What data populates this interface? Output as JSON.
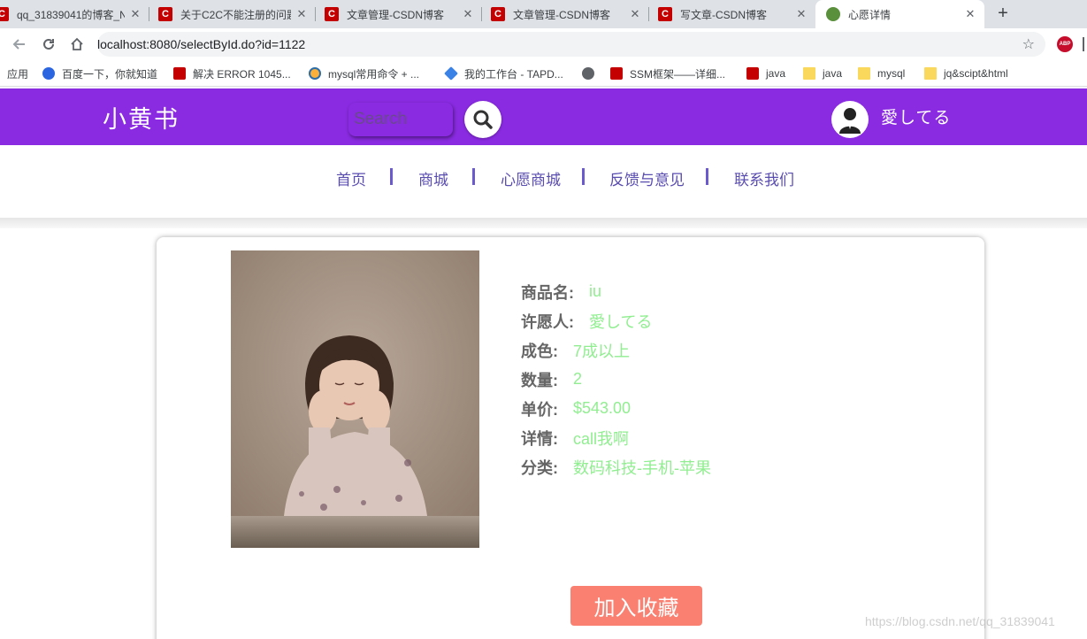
{
  "browser": {
    "tabs": [
      {
        "title": "qq_31839041的博客_N",
        "icon": "csdn-icon"
      },
      {
        "title": "关于C2C不能注册的问题",
        "icon": "csdn-icon"
      },
      {
        "title": "文章管理-CSDN博客",
        "icon": "csdn-icon"
      },
      {
        "title": "文章管理-CSDN博客",
        "icon": "csdn-icon"
      },
      {
        "title": "写文章-CSDN博客",
        "icon": "csdn-icon"
      },
      {
        "title": "心愿详情",
        "icon": "site-icon",
        "active": true
      }
    ],
    "url": "localhost:8080/selectById.do?id=1122",
    "bookmarks": [
      {
        "label": "应用",
        "icon": "apps-icon"
      },
      {
        "label": "百度一下，你就知道",
        "icon": "baidu-icon"
      },
      {
        "label": "解决 ERROR 1045...",
        "icon": "csdn-icon"
      },
      {
        "label": "mysql常用命令 + ...",
        "icon": "mysql-icon"
      },
      {
        "label": "我的工作台 - TAPD...",
        "icon": "tapd-icon"
      },
      {
        "label": "",
        "icon": "globe-icon"
      },
      {
        "label": "SSM框架——详细...",
        "icon": "csdn-icon"
      },
      {
        "label": "java",
        "icon": "csdn-icon"
      },
      {
        "label": "java",
        "icon": "folder-icon"
      },
      {
        "label": "mysql",
        "icon": "folder-icon"
      },
      {
        "label": "jq&scipt&html",
        "icon": "folder-icon"
      }
    ],
    "extension_label": "ABP"
  },
  "header": {
    "logo": "小黄书",
    "search_placeholder": "Search",
    "username": "愛してる",
    "bg_color": "#8a2be2"
  },
  "nav": {
    "items": [
      "首页",
      "商城",
      "心愿商城",
      "反馈与意见",
      "联系我们"
    ]
  },
  "detail": {
    "fields": [
      {
        "label": "商品名:",
        "value": "iu"
      },
      {
        "label": "许愿人:",
        "value": "愛してる"
      },
      {
        "label": "成色:",
        "value": "7成以上"
      },
      {
        "label": "数量:",
        "value": "2"
      },
      {
        "label": "单价:",
        "value": "$543.00"
      },
      {
        "label": "详情:",
        "value": "call我啊"
      },
      {
        "label": "分类:",
        "value": "数码科技-手机-苹果"
      }
    ],
    "favorite_button": "加入收藏",
    "value_color": "#90ee90",
    "button_color": "#fa8072"
  },
  "watermark": "https://blog.csdn.net/qq_31839041"
}
